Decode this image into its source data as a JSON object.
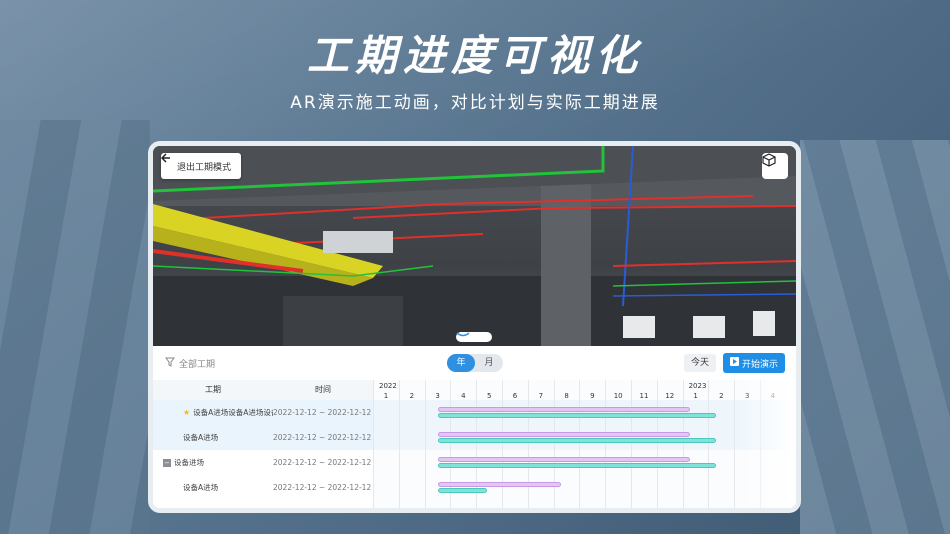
{
  "hero": {
    "title": "工期进度可视化",
    "subtitle": "AR演示施工动画，对比计划与实际工期进展"
  },
  "viewer": {
    "exit_label": "退出工期模式",
    "exit_icon": "arrow-left-icon",
    "cube_icon": "cube-icon",
    "handle_icon": "chevron-down-icon"
  },
  "toolbar": {
    "filter_label": "全部工期",
    "toggle": [
      "年",
      "月"
    ],
    "toggle_selected": "年",
    "today_label": "今天",
    "play_label": "开始演示"
  },
  "table": {
    "headers": {
      "name": "工期",
      "time": "时间"
    },
    "rows": [
      {
        "name": "设备A进场设备A进场设备A",
        "time": "2022-12-12 ~ 2022-12-12",
        "starred": true,
        "plan": [
          2.0,
          11.8
        ],
        "actual": [
          2.0,
          12.8
        ]
      },
      {
        "name": "设备A进场",
        "time": "2022-12-12 ~ 2022-12-12",
        "plan": [
          2.0,
          11.8
        ],
        "actual": [
          2.0,
          12.8
        ]
      },
      {
        "name": "设备进场",
        "time": "2022-12-12 ~ 2022-12-12",
        "group": true,
        "plan": [
          2.0,
          11.8
        ],
        "actual": [
          2.0,
          12.8
        ]
      },
      {
        "name": "设备A进场",
        "time": "2022-12-12 ~ 2022-12-12",
        "plan": [
          2.0,
          6.8
        ],
        "actual": [
          2.0,
          3.9
        ]
      }
    ]
  },
  "timeline": {
    "years": [
      {
        "label": "2022",
        "at": 0
      },
      {
        "label": "2023",
        "at": 12
      }
    ],
    "months": [
      "1",
      "2",
      "3",
      "4",
      "5",
      "6",
      "7",
      "8",
      "9",
      "10",
      "11",
      "12",
      "1",
      "2",
      "3",
      "4"
    ]
  },
  "colors": {
    "accent": "#1f8ee6",
    "plan": "#e3c6f3",
    "actual": "#7fe3d9"
  }
}
